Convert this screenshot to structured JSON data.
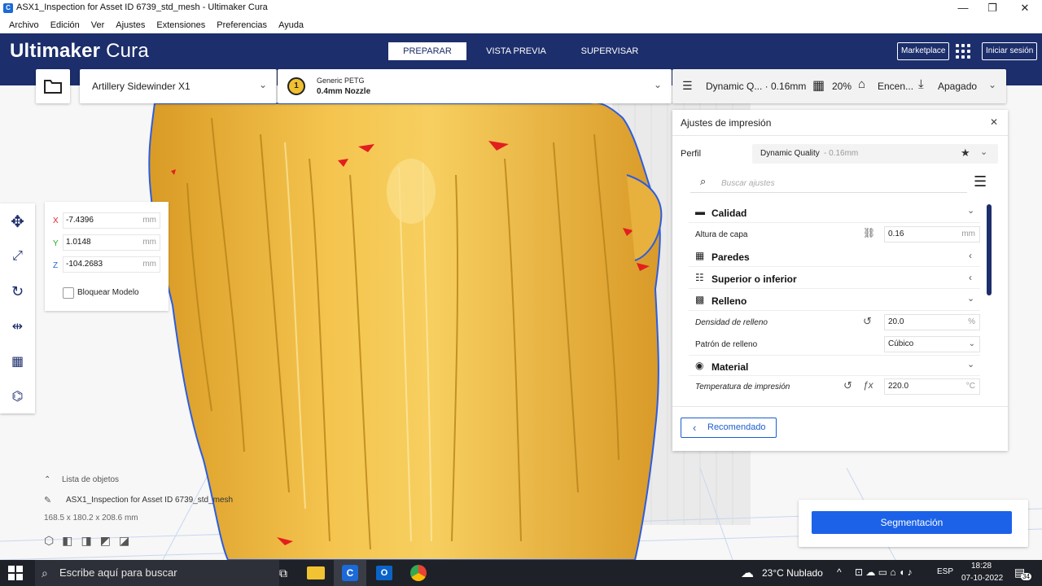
{
  "window": {
    "title": "ASX1_Inspection for Asset ID 6739_std_mesh - Ultimaker Cura",
    "minimize_glyph": "—",
    "maximize_glyph": "❐",
    "close_glyph": "✕"
  },
  "menu": [
    "Archivo",
    "Edición",
    "Ver",
    "Ajustes",
    "Extensiones",
    "Preferencias",
    "Ayuda"
  ],
  "header": {
    "brand_bold": "Ultimaker",
    "brand_light": "Cura",
    "stages": [
      "PREPARAR",
      "VISTA PREVIA",
      "SUPERVISAR"
    ],
    "active_stage": "PREPARAR",
    "marketplace": "Marketplace",
    "signin": "Iniciar sesión",
    "brand_color": "#1c2e6b"
  },
  "printer": {
    "name": "Artillery Sidewinder X1"
  },
  "material": {
    "extruder": "1",
    "name": "Generic PETG",
    "nozzle": "0.4mm Nozzle"
  },
  "print_summary": {
    "profile": "Dynamic Q... · 0.16mm",
    "infill": "20%",
    "support": "Encen...",
    "adhesion": "Apagado"
  },
  "move_panel": {
    "x_label": "X",
    "x_value": "-7.4396",
    "y_label": "Y",
    "y_value": "1.0148",
    "z_label": "Z",
    "z_value": "-104.2683",
    "unit": "mm",
    "lock_label": "Bloquear Modelo"
  },
  "settings_panel": {
    "title": "Ajustes de impresión",
    "profile_label": "Perfil",
    "profile_value": "Dynamic Quality",
    "profile_suffix": " - 0.16mm",
    "search_placeholder": "Buscar ajustes",
    "sections": {
      "quality": "Calidad",
      "layer_height_label": "Altura de capa",
      "layer_height_value": "0.16",
      "walls": "Paredes",
      "top_bottom": "Superior o inferior",
      "infill": "Relleno",
      "infill_density_label": "Densidad de relleno",
      "infill_density_value": "20.0",
      "infill_density_unit": "%",
      "infill_pattern_label": "Patrón de relleno",
      "infill_pattern_value": "Cúbico",
      "material": "Material",
      "print_temp_label": "Temperatura de impresión",
      "print_temp_value": "220.0",
      "temp_unit": "°C",
      "mm_unit": "mm"
    },
    "recommended_button": "Recomendado"
  },
  "object_list": {
    "header": "Lista de objetos",
    "object_name": "ASX1_Inspection for Asset ID 6739_std_mesh",
    "dimensions": "168.5 x 180.2 x 208.6 mm"
  },
  "slice_button": "Segmentación",
  "taskbar": {
    "search_placeholder": "Escribe aquí para buscar",
    "weather": "23°C  Nublado",
    "language": "ESP",
    "time": "18:28",
    "date": "07-10-2022",
    "notifications": "34"
  }
}
